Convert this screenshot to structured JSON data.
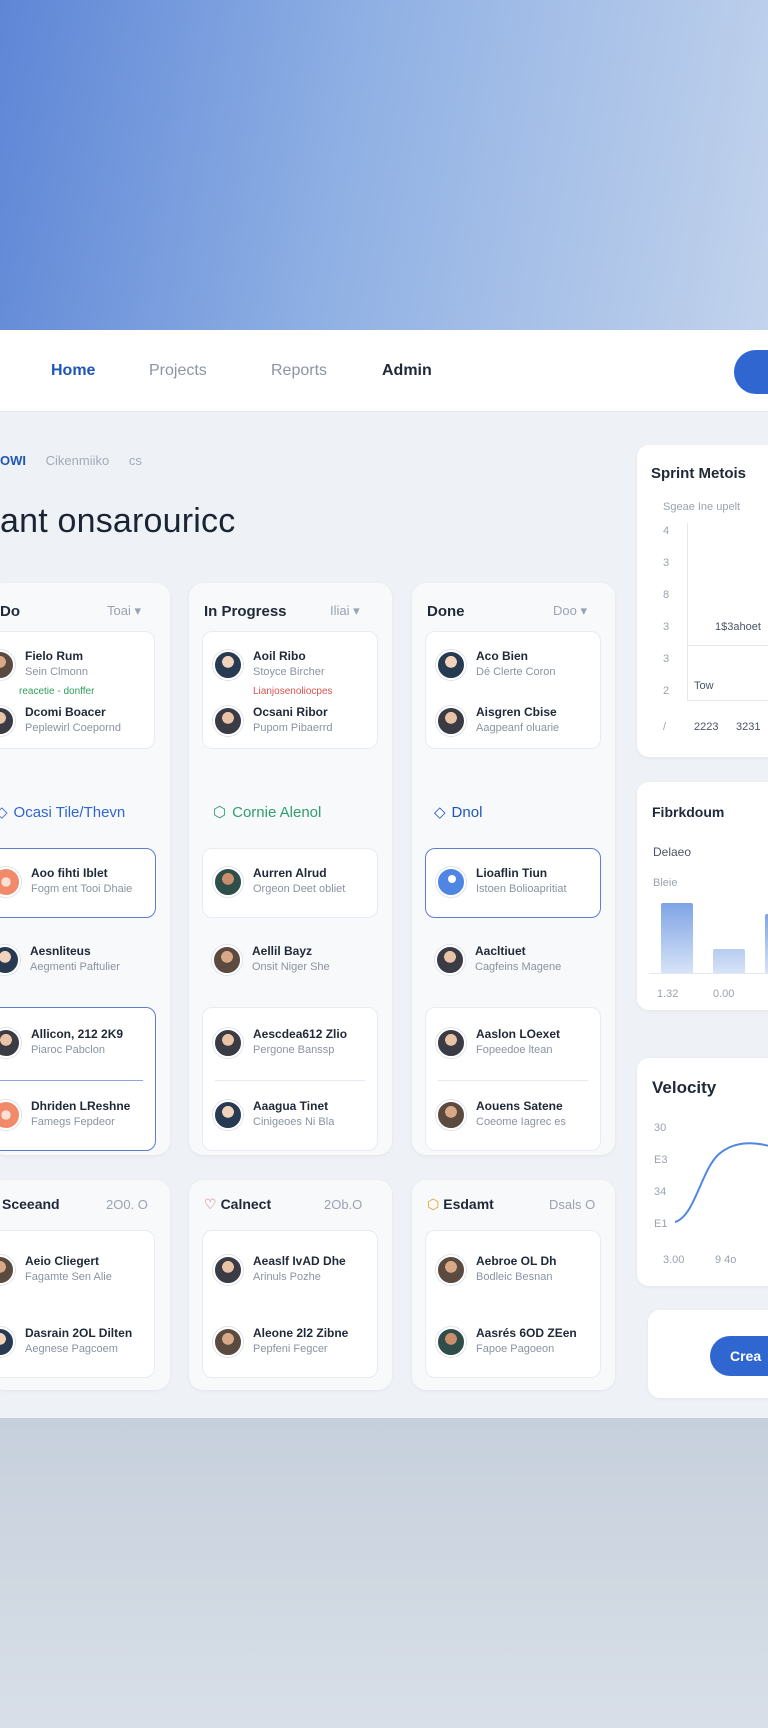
{
  "nav": {
    "links": [
      "Home",
      "Projects",
      "Reports",
      "Admin"
    ]
  },
  "breadcrumb": {
    "current": "OWI",
    "item": "Cikenmiiko",
    "sep": "cs"
  },
  "page_title": "ant onsarouricc",
  "columns": [
    {
      "title": "Do",
      "filter": "Toai ▾",
      "people": [
        {
          "name": "Fielo Rum",
          "sub": "Sein Clmonn"
        },
        {
          "name": "Dcomi Boacer",
          "sub": "Peplewirl Coepornd"
        }
      ],
      "tag_green": "reacetie - donffer",
      "section": "Ocasi Tile/Thevn",
      "tiles": [
        {
          "name": "Aoo fihti Iblet",
          "sub": "Fogm ent Tooi Dhaie"
        },
        {
          "name": "Aesnliteus",
          "sub": "Aegmenti Paftulier"
        }
      ],
      "pair": [
        {
          "name": "Allicon, 212 2K9",
          "sub": "Piaroc Pabclon"
        },
        {
          "name": "Dhriden LReshne",
          "sub": "Famegs Fepdeor"
        }
      ],
      "group": {
        "label": "Sceeand",
        "count": "2O0. O"
      },
      "group_people": [
        {
          "name": "Aeio Cliegert",
          "sub": "Fagamte Sen Alie"
        },
        {
          "name": "Dasrain 2OL Dilten",
          "sub": "Aegnese Pagcoem"
        }
      ]
    },
    {
      "title": "In Progress",
      "filter": "Iliai ▾",
      "people": [
        {
          "name": "Aoil Ribo",
          "sub": "Stoyce Bircher"
        },
        {
          "name": "Ocsani Ribor",
          "sub": "Pupom Pibaerrd"
        }
      ],
      "tag_red": "Lianjosenoliocpes",
      "section": "Cornie Alenol",
      "tiles": [
        {
          "name": "Aurren Alrud",
          "sub": "Orgeon Deet obliet"
        },
        {
          "name": "Aellil Bayz",
          "sub": "Onsit Niger She"
        }
      ],
      "pair": [
        {
          "name": "Aescdea612 Zlio",
          "sub": "Pergone Banssp"
        },
        {
          "name": "Aaagua Tinet",
          "sub": "Cinigeoes Ni Bla"
        }
      ],
      "group": {
        "label": "Calnect",
        "count": "2Ob.O"
      },
      "group_people": [
        {
          "name": "Aeaslf IvAD Dhe",
          "sub": "Arinuls Pozhe"
        },
        {
          "name": "Aleone 2l2 Zibne",
          "sub": "Pepfeni Fegcer"
        }
      ]
    },
    {
      "title": "Done",
      "filter": "Doo ▾",
      "people": [
        {
          "name": "Aco Bien",
          "sub": "Dé Clerte Coron"
        },
        {
          "name": "Aisgren Cbise",
          "sub": "Aagpeanf oluarie"
        }
      ],
      "section": "Dnol",
      "tiles": [
        {
          "name": "Lioaflin Tiun",
          "sub": "Istoen Bolioapritiat"
        },
        {
          "name": "Aacltiuet",
          "sub": "Cagfeins Magene"
        }
      ],
      "pair": [
        {
          "name": "Aaslon LOexet",
          "sub": "Fopeedoe ltean"
        },
        {
          "name": "Aouens Satene",
          "sub": "Coeome Iagrec es"
        }
      ],
      "group": {
        "label": "Esdamt",
        "count": "Dsals O"
      },
      "group_people": [
        {
          "name": "Aebroe OL Dh",
          "sub": "Bodleic Besnan"
        },
        {
          "name": "Aasrés 6OD ZEen",
          "sub": "Fapoe Pagoeon"
        }
      ]
    }
  ],
  "sprint": {
    "title": "Sprint Metois",
    "subtitle": "Sgeae Ine upelt",
    "y_ticks": [
      "4",
      "3",
      "8",
      "3",
      "3",
      "2"
    ],
    "mid_label": "1$3ahoet",
    "box_label": "Tow",
    "x_labels": [
      "2223",
      "3231"
    ],
    "corner": "/"
  },
  "breakdown": {
    "title": "Fibrkdoum",
    "label1": "Delaeo",
    "label2": "Bleie",
    "x_labels": [
      "1.32",
      "0.00"
    ],
    "bars": [
      {
        "value": 0.95,
        "color": "#7ea4e6"
      },
      {
        "value": 0.33,
        "color": "#b7cbf0"
      },
      {
        "value": 0.8,
        "color": "#7ea4e6"
      }
    ]
  },
  "velocity": {
    "title": "Velocity",
    "y_ticks": [
      "30",
      "E3",
      "34",
      "E1"
    ],
    "x_labels": [
      "3.00",
      "9 4o"
    ],
    "line_color": "#4f86e3"
  },
  "create_button": "Crea"
}
